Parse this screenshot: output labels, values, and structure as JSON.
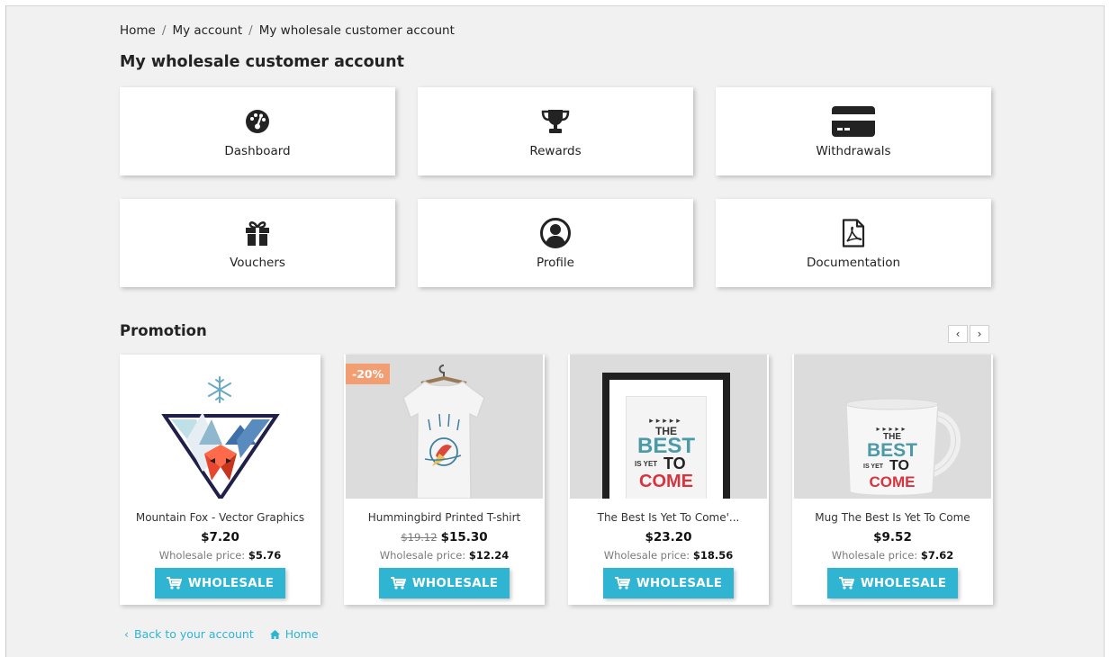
{
  "breadcrumb": {
    "items": [
      "Home",
      "My account",
      "My wholesale customer account"
    ],
    "separator": "/"
  },
  "page_title": "My wholesale customer account",
  "tiles": [
    {
      "label": "Dashboard",
      "icon": "dashboard-gauge-icon"
    },
    {
      "label": "Rewards",
      "icon": "trophy-icon"
    },
    {
      "label": "Withdrawals",
      "icon": "credit-card-icon"
    },
    {
      "label": "Vouchers",
      "icon": "gift-icon"
    },
    {
      "label": "Profile",
      "icon": "user-circle-icon"
    },
    {
      "label": "Documentation",
      "icon": "pdf-document-icon"
    }
  ],
  "promotion": {
    "title": "Promotion",
    "prev_label": "‹",
    "next_label": "›",
    "products": [
      {
        "name": "Mountain Fox - Vector Graphics",
        "price": "$7.20",
        "old_price": "",
        "badge": "",
        "wholesale_label": "Wholesale price:",
        "wholesale_price": "$5.76",
        "button": "WHOLESALE",
        "image": "mountain-fox-graphic"
      },
      {
        "name": "Hummingbird Printed T-shirt",
        "price": "$15.30",
        "old_price": "$19.12",
        "badge": "-20%",
        "wholesale_label": "Wholesale price:",
        "wholesale_price": "$12.24",
        "button": "WHOLESALE",
        "image": "hummingbird-tshirt"
      },
      {
        "name": "The Best Is Yet To Come'...",
        "price": "$23.20",
        "old_price": "",
        "badge": "",
        "wholesale_label": "Wholesale price:",
        "wholesale_price": "$18.56",
        "button": "WHOLESALE",
        "image": "best-is-yet-poster"
      },
      {
        "name": "Mug The Best Is Yet To Come",
        "price": "$9.52",
        "old_price": "",
        "badge": "",
        "wholesale_label": "Wholesale price:",
        "wholesale_price": "$7.62",
        "button": "WHOLESALE",
        "image": "best-is-yet-mug"
      }
    ],
    "artwork": {
      "line1": "THE",
      "line2": "BEST",
      "line3": "IS YET",
      "line4": "TO",
      "line5": "COME"
    }
  },
  "footer": {
    "back_label": "Back to your account",
    "home_label": "Home"
  },
  "colors": {
    "accent": "#2fb5d2",
    "badge": "#f39d72",
    "background": "#f1f1f1"
  }
}
